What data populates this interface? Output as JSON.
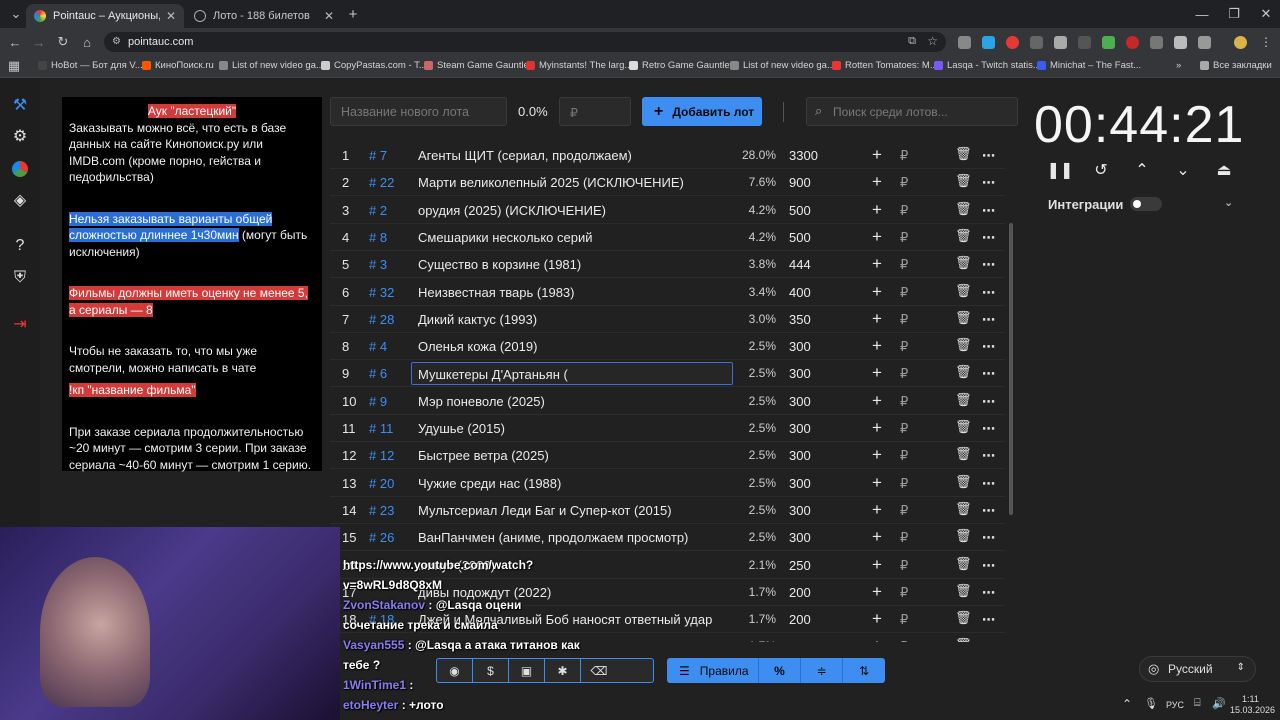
{
  "browser": {
    "tabs": [
      {
        "title": "Pointauc – Аукционы, лотерей"
      },
      {
        "title": "Лото - 188 билетов"
      }
    ],
    "url": "pointauc.com",
    "bookmarks": [
      "HoBot — Бот для V...",
      "КиноПоиск.ru",
      "List of new video ga...",
      "CopyPastas.com - T...",
      "Steam Game Gauntlet",
      "Myinstants! The larg...",
      "Retro Game Gauntlet",
      "List of new video ga...",
      "Rotten Tomatoes: M...",
      "Lasqa - Twitch statis...",
      "Minichat – The Fast...",
      "Все закладки"
    ]
  },
  "rules": {
    "title": "Аук \"ластецкий\"",
    "p1": "Заказывать можно всё, что есть в базе данных на сайте Кинопоиск.ру или IMDB.com (кроме порно, гейства и педофильства)",
    "p2_hl": "Нельзя заказывать варианты общей сложностью длиннее 1ч30мин",
    "p2_rest": " (могут быть исключения)",
    "p3": "Фильмы должны иметь оценку не менее 5, а сериалы — 8",
    "p4": "Чтобы не заказать то, что мы уже смотрели, можно написать в чате",
    "p4_hl": "!кп \"название фильма\"",
    "p5": "При заказе сериала продолжительностью ~20 минут — смотрим 3 серии. При заказе сериала ~40-60 минут — смотрим 1 серию."
  },
  "lot_bar": {
    "name_placeholder": "Название нового лота",
    "percent": "0.0%",
    "amount_placeholder": "₽",
    "add_label": "Добавить лот",
    "search_placeholder": "Поиск среди лотов..."
  },
  "lots": [
    {
      "n": "1",
      "id": "# 7",
      "name": "Агенты ЩИТ (сериал, продолжаем)",
      "pct": "28.0%",
      "amt": "3300"
    },
    {
      "n": "2",
      "id": "# 22",
      "name": "Марти великолепный 2025 (ИСКЛЮЧЕНИЕ)",
      "pct": "7.6%",
      "amt": "900"
    },
    {
      "n": "3",
      "id": "# 2",
      "name": "орудия (2025) (ИСКЛЮЧЕНИЕ)",
      "pct": "4.2%",
      "amt": "500"
    },
    {
      "n": "4",
      "id": "# 8",
      "name": "Смешарики несколько серий",
      "pct": "4.2%",
      "amt": "500"
    },
    {
      "n": "5",
      "id": "# 3",
      "name": "Существо в корзине (1981)",
      "pct": "3.8%",
      "amt": "444"
    },
    {
      "n": "6",
      "id": "# 32",
      "name": "Неизвестная тварь (1983)",
      "pct": "3.4%",
      "amt": "400"
    },
    {
      "n": "7",
      "id": "# 28",
      "name": "Дикий кактус (1993)",
      "pct": "3.0%",
      "amt": "350"
    },
    {
      "n": "8",
      "id": "# 4",
      "name": "Оленья кожа (2019)",
      "pct": "2.5%",
      "amt": "300"
    },
    {
      "n": "9",
      "id": "# 6",
      "name": "Мушкетеры Д'Артаньян (",
      "pct": "2.5%",
      "amt": "300"
    },
    {
      "n": "10",
      "id": "# 9",
      "name": "Мэр поневоле (2025)",
      "pct": "2.5%",
      "amt": "300"
    },
    {
      "n": "11",
      "id": "# 11",
      "name": "Удушье (2015)",
      "pct": "2.5%",
      "amt": "300"
    },
    {
      "n": "12",
      "id": "# 12",
      "name": "Быстрее ветра (2025)",
      "pct": "2.5%",
      "amt": "300"
    },
    {
      "n": "13",
      "id": "# 20",
      "name": "Чужие среди нас (1988)",
      "pct": "2.5%",
      "amt": "300"
    },
    {
      "n": "14",
      "id": "# 23",
      "name": "Мультсериал Леди Баг и Супер-кот (2015)",
      "pct": "2.5%",
      "amt": "300"
    },
    {
      "n": "15",
      "id": "# 26",
      "name": "ВанПанчмен (аниме, продолжаем просмотр)",
      "pct": "2.5%",
      "amt": "300"
    },
    {
      "n": "16",
      "id": "",
      "name": "минут (2008)",
      "pct": "2.1%",
      "amt": "250"
    },
    {
      "n": "17",
      "id": "",
      "name": "дивы подождут (2022)",
      "pct": "1.7%",
      "amt": "200"
    },
    {
      "n": "18",
      "id": "# 18",
      "name": "Джей и Молчаливый Боб наносят ответный удар",
      "pct": "1.7%",
      "amt": "200"
    },
    {
      "n": "19",
      "id": "",
      "name": "",
      "pct": "1.7%",
      "amt": "200"
    }
  ],
  "currency": "₽",
  "timer": "00:44:21",
  "integrations_label": "Интеграции",
  "bottom": {
    "rules_label": "Правила",
    "lang": "Русский"
  },
  "chat": [
    {
      "u": "",
      "m": "https://www.youtube.com/watch?"
    },
    {
      "u": "",
      "m": "v=8wRL9d8Q8xM"
    },
    {
      "u": "ZvonStakanov",
      "m": " : @Lasqa оцени"
    },
    {
      "u": "",
      "m": "сочетание трека и смайла"
    },
    {
      "u": "Vasyan555",
      "m": " : @Lasqa а атака титанов как"
    },
    {
      "u": "",
      "m": "тебе ?"
    },
    {
      "u": "1WinTime1",
      "m": " :"
    },
    {
      "u": "etoHeyter",
      "m": " : +лото"
    }
  ],
  "tray": {
    "lang": "РУС",
    "time": "1:11",
    "date": "15.03.2026"
  }
}
